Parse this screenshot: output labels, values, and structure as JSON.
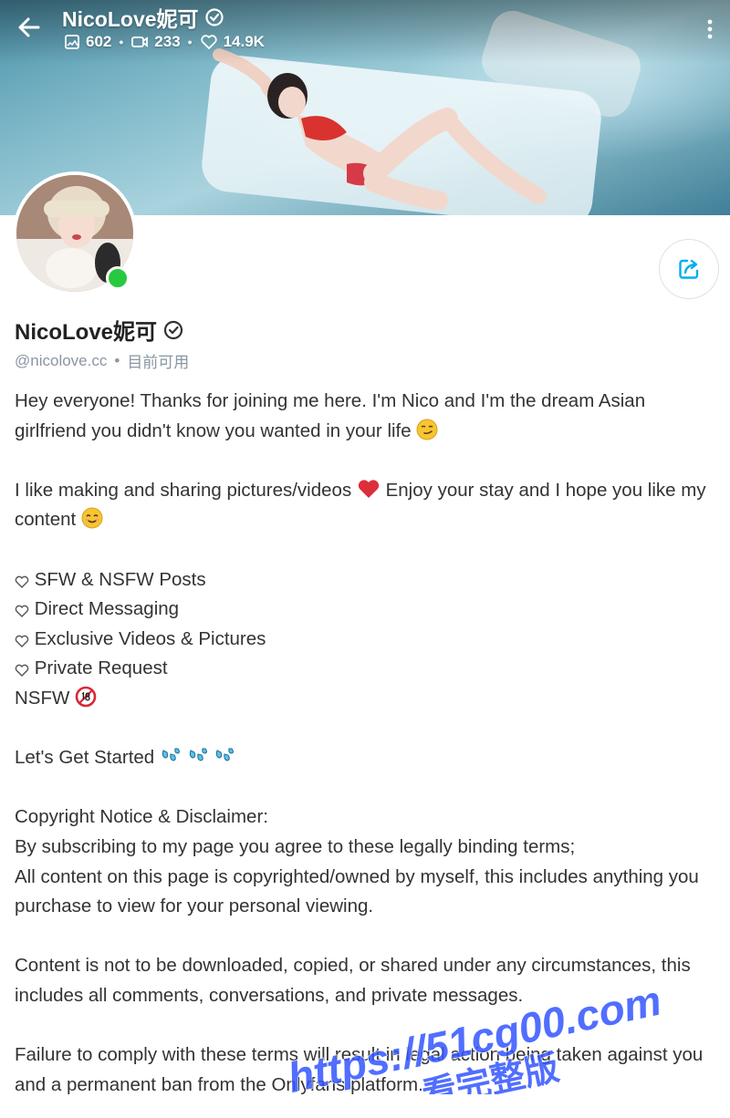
{
  "header": {
    "title": "NicoLove妮可",
    "stats": {
      "photos": "602",
      "videos": "233",
      "likes": "14.9K"
    }
  },
  "profile": {
    "name": "NicoLove妮可",
    "handle": "@nicolove.cc",
    "status": "目前可用"
  },
  "bio": {
    "line1": "Hey everyone! Thanks for joining me here. I'm Nico and I'm the dream Asian girlfriend you didn't know you wanted in your life",
    "line2a": "I like making and sharing pictures/videos",
    "line2b": "Enjoy your stay and I hope you like my content",
    "list": [
      "SFW & NSFW Posts",
      "Direct Messaging",
      "Exclusive Videos & Pictures",
      "Private Request"
    ],
    "nsfw": "NSFW",
    "started": "Let's Get Started",
    "copyright_title": "Copyright Notice & Disclaimer:",
    "copyright_1": "By subscribing to my page you agree to these legally binding terms;",
    "copyright_2": "All content on this page is copyrighted/owned by myself, this includes anything you purchase to view for your personal viewing.",
    "content_rule": "Content is not to be downloaded, copied, or shared under any circumstances, this includes all comments, conversations, and private messages.",
    "failure": "Failure to comply with these terms will result in legal action being taken against you and a permanent ban from the Onlyfans platform."
  },
  "watermark": {
    "url": "https://51cg00.com",
    "label": "看完整版"
  },
  "colors": {
    "accent": "#00aff0",
    "online": "#27c93f",
    "watermark": "#3355ff"
  }
}
